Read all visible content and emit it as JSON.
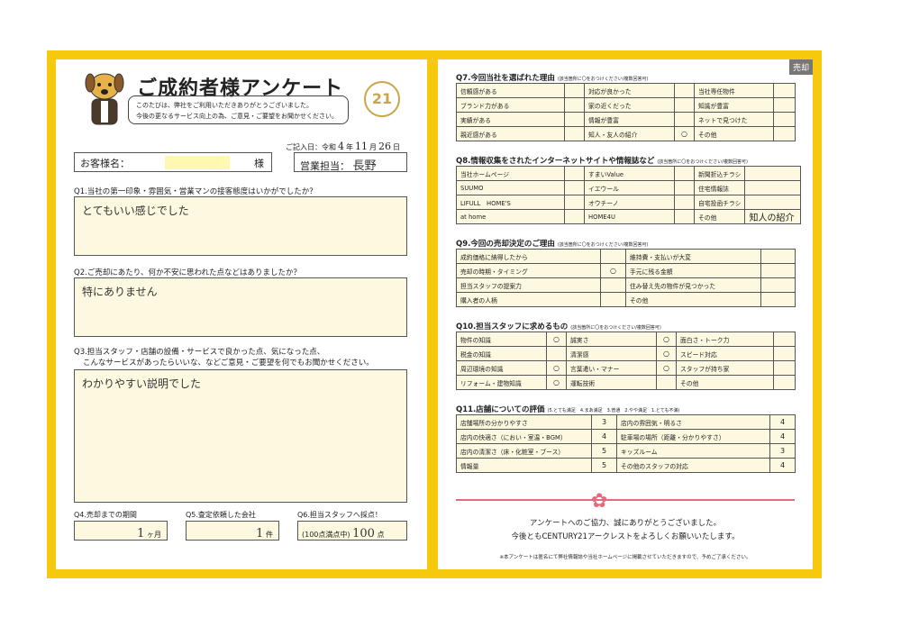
{
  "badge": "売却",
  "title": "ご成約者様アンケート",
  "intro": [
    "このたびは、弊社をご利用いただきありがとうございました。",
    "今後の更なるサービス向上の為、ご意見・ご要望をお聞かせください。"
  ],
  "logo": "21",
  "date": {
    "prefix": "ご記入日：令和",
    "year": "4",
    "year_unit": "年",
    "month": "11",
    "month_unit": "月",
    "day": "26",
    "day_unit": "日"
  },
  "customer": {
    "label": "お客様名：",
    "suffix": "様"
  },
  "staff": {
    "label": "営業担当：",
    "value": "長野"
  },
  "q1": {
    "question": "Q1.当社の第一印象・雰囲気・営業マンの接客態度はいかがでしたか？",
    "answer": "とてもいい感じでした"
  },
  "q2": {
    "question": "Q2.ご売却にあたり、何か不安に思われた点などはありましたか？",
    "answer": "特にありません"
  },
  "q3": {
    "question1": "Q3.担当スタッフ・店舗の設備・サービスで良かった点、気になった点、",
    "question2": "こんなサービスがあったらいいな、などご意見・ご要望を何でもお聞かせください。",
    "answer": "わかりやすい説明でした"
  },
  "q4": {
    "label": "Q4.売却までの期間",
    "value": "1",
    "unit": "ヶ月"
  },
  "q5": {
    "label": "Q5.査定依頼した会社",
    "value": "1",
    "unit": "件"
  },
  "q6": {
    "label": "Q6.担当スタッフへ採点！",
    "prefix": "(100点満点中)",
    "value": "100",
    "unit": "点"
  },
  "q7": {
    "title": "Q7.今回当社を選ばれた理由",
    "note": "(該当箇所に〇をおつけください/複数回答可)",
    "rows": [
      [
        "信頼感がある",
        "",
        "対応が良かった",
        "",
        "当社専任物件",
        ""
      ],
      [
        "ブランド力がある",
        "",
        "家の近くだった",
        "",
        "知識が豊富",
        ""
      ],
      [
        "実績がある",
        "",
        "情報が豊富",
        "",
        "ネットで見つけた",
        ""
      ],
      [
        "親近感がある",
        "",
        "知人・友人の紹介",
        "○",
        "その他",
        ""
      ]
    ]
  },
  "q8": {
    "title": "Q8.情報収集をされたインターネットサイトや情報誌など",
    "note": "(該当箇所に〇をおつけください/複数回答可)",
    "rows": [
      [
        "当社ホームページ",
        "",
        "すまいValue",
        "",
        "新聞折込チラシ",
        ""
      ],
      [
        "SUUMO",
        "",
        "イエウール",
        "",
        "住宅情報誌",
        ""
      ],
      [
        "LIFULL　HOME'S",
        "",
        "オウチーノ",
        "",
        "自宅投函チラシ",
        ""
      ],
      [
        "at home",
        "",
        "HOME4U",
        "",
        "その他",
        "知人の紹介"
      ]
    ]
  },
  "q9": {
    "title": "Q9.今回の売却決定のご理由",
    "note": "(該当箇所に〇をおつけください/複数回答可)",
    "rows": [
      [
        "成約価格に納得したから",
        "",
        "維持費・支払いが大変",
        ""
      ],
      [
        "売却の時期・タイミング",
        "○",
        "手元に残る金額",
        ""
      ],
      [
        "担当スタッフの提案力",
        "",
        "住み替え先の物件が見つかった",
        ""
      ],
      [
        "購入者の人柄",
        "",
        "その他",
        ""
      ]
    ]
  },
  "q10": {
    "title": "Q10.担当スタッフに求めるもの",
    "note": "(該当箇所に〇をおつけください/複数回答可)",
    "rows": [
      [
        "物件の知識",
        "○",
        "誠実さ",
        "○",
        "面白さ・トーク力",
        ""
      ],
      [
        "税金の知識",
        "",
        "清潔感",
        "○",
        "スピード対応",
        ""
      ],
      [
        "周辺環境の知識",
        "○",
        "言葉遣い・マナー",
        "○",
        "スタッフが持ち家",
        ""
      ],
      [
        "リフォーム・建物知識",
        "○",
        "運転技術",
        "",
        "その他",
        ""
      ]
    ]
  },
  "q11": {
    "title": "Q11.店舗についての評価",
    "scale": "(5.とても満足　4.まあ満足　3.普通　2.やや満足　1.とても不満)",
    "rows": [
      [
        "店舗場所の分かりやすさ",
        "3",
        "店内の雰囲気・明るさ",
        "4"
      ],
      [
        "店内の快適さ（におい・室温・BGM）",
        "4",
        "駐車場の場所（距離・分かりやすさ）",
        "4"
      ],
      [
        "店内の清潔さ（床・化粧室・ブース）",
        "5",
        "キッズルーム",
        "3"
      ],
      [
        "情報量",
        "5",
        "その他のスタッフの対応",
        "4"
      ]
    ]
  },
  "thanks": [
    "アンケートへのご協力、誠にありがとうございました。",
    "今後ともCENTURY21アークレストをよろしくお願いいたします。"
  ],
  "footnote": "※本アンケートは匿名にて弊社情報誌や当社ホームページに掲載させていただきますので、予めご了承ください。",
  "colors": {
    "frame": "#f6c90e",
    "fill": "#fdf9e0",
    "ribbon": "#e56b7a",
    "logo": "#c9a64a"
  }
}
